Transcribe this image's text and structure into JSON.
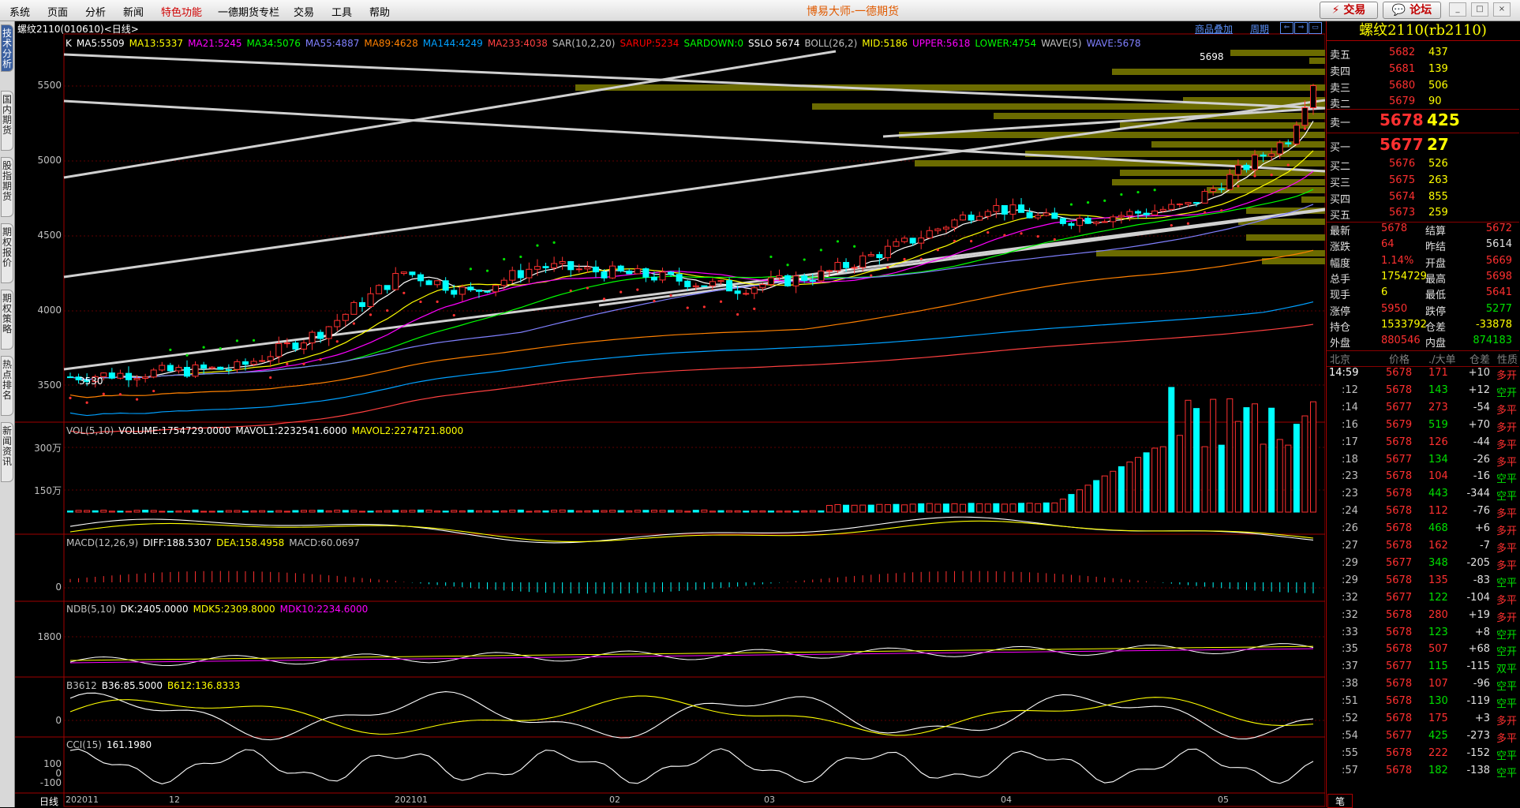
{
  "menu": {
    "items": [
      "系统",
      "页面",
      "分析",
      "新闻",
      "特色功能",
      "一德期货专栏",
      "交易",
      "工具",
      "帮助"
    ],
    "title": "博易大师-一德期货",
    "trade_label": "交易",
    "forum_label": "论坛"
  },
  "left_tabs": [
    "技术分析",
    "国内期货",
    "股指期货",
    "期权报价",
    "期权策略",
    "热点排名",
    "新闻资讯"
  ],
  "header": {
    "symbol": "螺纹2110(010610)<日线>",
    "link_overlay": "商品叠加",
    "link_period": "周期"
  },
  "main_indicators": [
    {
      "text": "K",
      "color": "#ffffff"
    },
    {
      "text": "MA5:5509",
      "color": "#ffffff"
    },
    {
      "text": "MA13:5337",
      "color": "#ffff00"
    },
    {
      "text": "MA21:5245",
      "color": "#ff00ff"
    },
    {
      "text": "MA34:5076",
      "color": "#00ff00"
    },
    {
      "text": "MA55:4887",
      "color": "#8080ff"
    },
    {
      "text": "MA89:4628",
      "color": "#ff8000"
    },
    {
      "text": "MA144:4249",
      "color": "#00a0ff"
    },
    {
      "text": "MA233:4038",
      "color": "#ff4040"
    },
    {
      "text": "SAR(10,2,20)",
      "color": "#c0c0c0"
    },
    {
      "text": "SARUP:5234",
      "color": "#ff0000"
    },
    {
      "text": "SARDOWN:0",
      "color": "#00ff00"
    },
    {
      "text": "SSLO 5674",
      "color": "#ffffff"
    },
    {
      "text": "BOLL(26,2)",
      "color": "#c0c0c0"
    },
    {
      "text": "MID:5186",
      "color": "#ffff00"
    },
    {
      "text": "UPPER:5618",
      "color": "#ff00ff"
    },
    {
      "text": "LOWER:4754",
      "color": "#00ff00"
    },
    {
      "text": "WAVE(5)",
      "color": "#c0c0c0"
    },
    {
      "text": "WAVE:5678",
      "color": "#8080ff"
    }
  ],
  "vol_indicators": [
    {
      "text": "VOL(5,10)",
      "color": "#c0c0c0"
    },
    {
      "text": "VOLUME:1754729.0000",
      "color": "#ffffff"
    },
    {
      "text": "MAVOL1:2232541.6000",
      "color": "#ffffff"
    },
    {
      "text": "MAVOL2:2274721.8000",
      "color": "#ffff00"
    }
  ],
  "macd_indicators": [
    {
      "text": "MACD(12,26,9)",
      "color": "#c0c0c0"
    },
    {
      "text": "DIFF:188.5307",
      "color": "#ffffff"
    },
    {
      "text": "DEA:158.4958",
      "color": "#ffff00"
    },
    {
      "text": "MACD:60.0697",
      "color": "#c0c0c0"
    }
  ],
  "ndb_indicators": [
    {
      "text": "NDB(5,10)",
      "color": "#c0c0c0"
    },
    {
      "text": "DK:2405.0000",
      "color": "#ffffff"
    },
    {
      "text": "MDK5:2309.8000",
      "color": "#ffff00"
    },
    {
      "text": "MDK10:2234.6000",
      "color": "#ff00ff"
    }
  ],
  "b3612_indicators": [
    {
      "text": "B3612",
      "color": "#c0c0c0"
    },
    {
      "text": "B36:85.5000",
      "color": "#ffffff"
    },
    {
      "text": "B612:136.8333",
      "color": "#ffff00"
    }
  ],
  "cci_indicators": [
    {
      "text": "CCI(15)",
      "color": "#c0c0c0"
    },
    {
      "text": "161.1980",
      "color": "#ffffff"
    }
  ],
  "y_axis_main": [
    "5500",
    "5000",
    "4500",
    "4000",
    "3500"
  ],
  "y_axis_vol": [
    "300万",
    "150万"
  ],
  "y_axis_macd": [
    "0"
  ],
  "y_axis_ndb": [
    "1800"
  ],
  "y_axis_b3612": [
    "0"
  ],
  "y_axis_cci": [
    "100",
    "0",
    "-100"
  ],
  "price_marks": {
    "high": "5698",
    "low": "3530"
  },
  "x_axis": {
    "period": "日线",
    "labels": [
      "202011",
      "12",
      "202101",
      "02",
      "03",
      "04",
      "05"
    ]
  },
  "quote": {
    "title": "螺纹2110(rb2110)",
    "asks": [
      {
        "label": "卖五",
        "price": "5682",
        "vol": "437"
      },
      {
        "label": "卖四",
        "price": "5681",
        "vol": "139"
      },
      {
        "label": "卖三",
        "price": "5680",
        "vol": "506"
      },
      {
        "label": "卖二",
        "price": "5679",
        "vol": "90"
      }
    ],
    "ask1": {
      "label": "卖一",
      "price": "5678",
      "vol": "425"
    },
    "bid1": {
      "label": "买一",
      "price": "5677",
      "vol": "27"
    },
    "bids": [
      {
        "label": "买二",
        "price": "5676",
        "vol": "526"
      },
      {
        "label": "买三",
        "price": "5675",
        "vol": "263"
      },
      {
        "label": "买四",
        "price": "5674",
        "vol": "855"
      },
      {
        "label": "买五",
        "price": "5673",
        "vol": "259"
      }
    ],
    "stats": [
      {
        "l1": "最新",
        "v1": "5678",
        "c1": "#ff3030",
        "l2": "结算",
        "v2": "5672",
        "c2": "#ff3030"
      },
      {
        "l1": "涨跌",
        "v1": "64",
        "c1": "#ff3030",
        "l2": "昨结",
        "v2": "5614",
        "c2": "#e0e0e0"
      },
      {
        "l1": "幅度",
        "v1": "1.14%",
        "c1": "#ff3030",
        "l2": "开盘",
        "v2": "5669",
        "c2": "#ff3030"
      },
      {
        "l1": "总手",
        "v1": "1754729",
        "c1": "#ffff00",
        "l2": "最高",
        "v2": "5698",
        "c2": "#ff3030"
      },
      {
        "l1": "现手",
        "v1": "6",
        "c1": "#ffff00",
        "l2": "最低",
        "v2": "5641",
        "c2": "#ff3030"
      },
      {
        "l1": "涨停",
        "v1": "5950",
        "c1": "#ff3030",
        "l2": "跌停",
        "v2": "5277",
        "c2": "#00e000"
      },
      {
        "l1": "持仓",
        "v1": "1533792",
        "c1": "#ffff00",
        "l2": "仓差",
        "v2": "-33878",
        "c2": "#ffff00"
      },
      {
        "l1": "外盘",
        "v1": "880546",
        "c1": "#ff3030",
        "l2": "内盘",
        "v2": "874183",
        "c2": "#00e000"
      }
    ],
    "ticks_header": {
      "place": "北京",
      "price": "价格",
      "vol": "./大单",
      "oi": "仓差",
      "nature": "性质"
    },
    "ticks": [
      {
        "t": "14:59",
        "p": "5678",
        "v": "171",
        "d": "+10",
        "n": "多开"
      },
      {
        "t": ":12",
        "p": "5678",
        "v": "143",
        "d": "+12",
        "n": "空开"
      },
      {
        "t": ":14",
        "p": "5677",
        "v": "273",
        "d": "-54",
        "n": "多平"
      },
      {
        "t": ":16",
        "p": "5679",
        "v": "519",
        "d": "+70",
        "n": "多开"
      },
      {
        "t": ":17",
        "p": "5678",
        "v": "126",
        "d": "-44",
        "n": "多平"
      },
      {
        "t": ":18",
        "p": "5677",
        "v": "134",
        "d": "-26",
        "n": "多平"
      },
      {
        "t": ":23",
        "p": "5678",
        "v": "104",
        "d": "-16",
        "n": "空平"
      },
      {
        "t": ":23",
        "p": "5678",
        "v": "443",
        "d": "-344",
        "n": "空平"
      },
      {
        "t": ":24",
        "p": "5678",
        "v": "112",
        "d": "-76",
        "n": "多平"
      },
      {
        "t": ":26",
        "p": "5678",
        "v": "468",
        "d": "+6",
        "n": "多开"
      },
      {
        "t": ":27",
        "p": "5678",
        "v": "162",
        "d": "-7",
        "n": "多平"
      },
      {
        "t": ":29",
        "p": "5677",
        "v": "348",
        "d": "-205",
        "n": "多平"
      },
      {
        "t": ":29",
        "p": "5678",
        "v": "135",
        "d": "-83",
        "n": "空平"
      },
      {
        "t": ":32",
        "p": "5677",
        "v": "122",
        "d": "-104",
        "n": "多平"
      },
      {
        "t": ":32",
        "p": "5678",
        "v": "280",
        "d": "+19",
        "n": "多开"
      },
      {
        "t": ":33",
        "p": "5678",
        "v": "123",
        "d": "+8",
        "n": "空开"
      },
      {
        "t": ":35",
        "p": "5678",
        "v": "507",
        "d": "+68",
        "n": "空开"
      },
      {
        "t": ":37",
        "p": "5677",
        "v": "115",
        "d": "-115",
        "n": "双平"
      },
      {
        "t": ":38",
        "p": "5678",
        "v": "107",
        "d": "-96",
        "n": "空平"
      },
      {
        "t": ":51",
        "p": "5678",
        "v": "130",
        "d": "-119",
        "n": "空平"
      },
      {
        "t": ":52",
        "p": "5678",
        "v": "175",
        "d": "+3",
        "n": "多开"
      },
      {
        "t": ":54",
        "p": "5677",
        "v": "425",
        "d": "-273",
        "n": "多平"
      },
      {
        "t": ":55",
        "p": "5678",
        "v": "222",
        "d": "-152",
        "n": "空平"
      },
      {
        "t": ":57",
        "p": "5678",
        "v": "182",
        "d": "-138",
        "n": "空平"
      }
    ],
    "bottom_tab": "笔"
  }
}
